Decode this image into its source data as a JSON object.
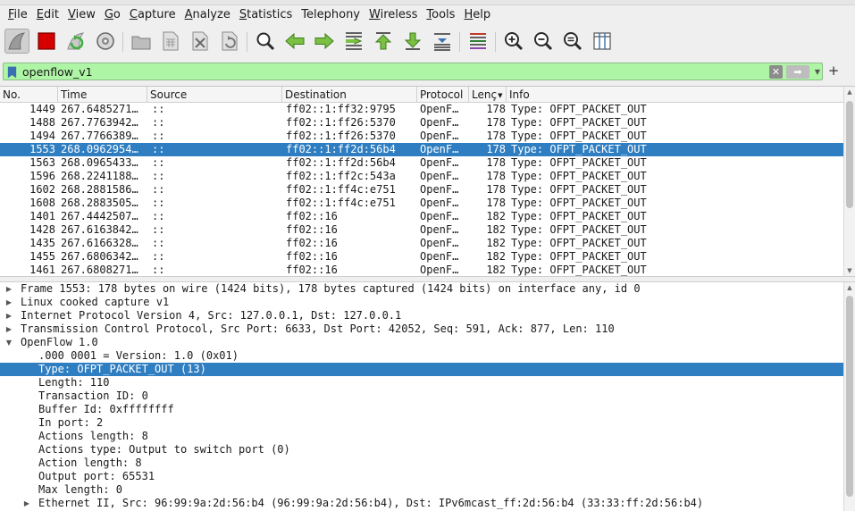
{
  "menu": [
    {
      "label": "File",
      "accel": "F",
      "rest": "ile"
    },
    {
      "label": "Edit",
      "accel": "E",
      "rest": "dit"
    },
    {
      "label": "View",
      "accel": "V",
      "rest": "iew"
    },
    {
      "label": "Go",
      "accel": "G",
      "rest": "o"
    },
    {
      "label": "Capture",
      "accel": "C",
      "rest": "apture"
    },
    {
      "label": "Analyze",
      "accel": "A",
      "rest": "nalyze"
    },
    {
      "label": "Statistics",
      "accel": "S",
      "rest": "tatistics"
    },
    {
      "label": "Telephony",
      "accel": "",
      "rest": "Telephony"
    },
    {
      "label": "Wireless",
      "accel": "W",
      "rest": "ireless"
    },
    {
      "label": "Tools",
      "accel": "T",
      "rest": "ools"
    },
    {
      "label": "Help",
      "accel": "H",
      "rest": "elp"
    }
  ],
  "toolbar": {
    "icons": [
      "shark-fin-start-icon",
      "stop-capture-icon",
      "restart-capture-icon",
      "capture-options-icon",
      "open-file-icon",
      "save-file-icon",
      "close-file-icon",
      "reload-file-icon",
      "find-packet-icon",
      "go-back-icon",
      "go-forward-icon",
      "go-to-packet-icon",
      "go-first-icon",
      "go-last-icon",
      "autoscroll-icon",
      "colorize-icon",
      "zoom-in-icon",
      "zoom-out-icon",
      "zoom-normal-icon",
      "resize-columns-icon"
    ],
    "accent_green": "#3fae3f",
    "accent_red": "#d60000"
  },
  "filter": {
    "value": "openflow_v1",
    "background": "#aff5a6",
    "plus": "+"
  },
  "packet_list": {
    "columns": [
      "No.",
      "Time",
      "Source",
      "Destination",
      "Protocol",
      "Lenç",
      "Info"
    ],
    "selected_color": "#2f7ec1",
    "rows": [
      {
        "no": "1449",
        "time": "267.6485271…",
        "src": "::",
        "dst": "ff02::1:ff32:9795",
        "proto": "OpenF…",
        "len": "178",
        "info": "Type: OFPT_PACKET_OUT"
      },
      {
        "no": "1488",
        "time": "267.7763942…",
        "src": "::",
        "dst": "ff02::1:ff26:5370",
        "proto": "OpenF…",
        "len": "178",
        "info": "Type: OFPT_PACKET_OUT"
      },
      {
        "no": "1494",
        "time": "267.7766389…",
        "src": "::",
        "dst": "ff02::1:ff26:5370",
        "proto": "OpenF…",
        "len": "178",
        "info": "Type: OFPT_PACKET_OUT"
      },
      {
        "no": "1553",
        "time": "268.0962954…",
        "src": "::",
        "dst": "ff02::1:ff2d:56b4",
        "proto": "OpenF…",
        "len": "178",
        "info": "Type: OFPT_PACKET_OUT"
      },
      {
        "no": "1563",
        "time": "268.0965433…",
        "src": "::",
        "dst": "ff02::1:ff2d:56b4",
        "proto": "OpenF…",
        "len": "178",
        "info": "Type: OFPT_PACKET_OUT"
      },
      {
        "no": "1596",
        "time": "268.2241188…",
        "src": "::",
        "dst": "ff02::1:ff2c:543a",
        "proto": "OpenF…",
        "len": "178",
        "info": "Type: OFPT_PACKET_OUT"
      },
      {
        "no": "1602",
        "time": "268.2881586…",
        "src": "::",
        "dst": "ff02::1:ff4c:e751",
        "proto": "OpenF…",
        "len": "178",
        "info": "Type: OFPT_PACKET_OUT"
      },
      {
        "no": "1608",
        "time": "268.2883505…",
        "src": "::",
        "dst": "ff02::1:ff4c:e751",
        "proto": "OpenF…",
        "len": "178",
        "info": "Type: OFPT_PACKET_OUT"
      },
      {
        "no": "1401",
        "time": "267.4442507…",
        "src": "::",
        "dst": "ff02::16",
        "proto": "OpenF…",
        "len": "182",
        "info": "Type: OFPT_PACKET_OUT"
      },
      {
        "no": "1428",
        "time": "267.6163842…",
        "src": "::",
        "dst": "ff02::16",
        "proto": "OpenF…",
        "len": "182",
        "info": "Type: OFPT_PACKET_OUT"
      },
      {
        "no": "1435",
        "time": "267.6166328…",
        "src": "::",
        "dst": "ff02::16",
        "proto": "OpenF…",
        "len": "182",
        "info": "Type: OFPT_PACKET_OUT"
      },
      {
        "no": "1455",
        "time": "267.6806342…",
        "src": "::",
        "dst": "ff02::16",
        "proto": "OpenF…",
        "len": "182",
        "info": "Type: OFPT_PACKET_OUT"
      },
      {
        "no": "1461",
        "time": "267.6808271…",
        "src": "::",
        "dst": "ff02::16",
        "proto": "OpenF…",
        "len": "182",
        "info": "Type: OFPT_PACKET_OUT"
      }
    ],
    "selected_index": 3
  },
  "details": {
    "rows": [
      {
        "level": 0,
        "expander": "collapsed",
        "text": "Frame 1553: 178 bytes on wire (1424 bits), 178 bytes captured (1424 bits) on interface any, id 0"
      },
      {
        "level": 0,
        "expander": "collapsed",
        "text": "Linux cooked capture v1"
      },
      {
        "level": 0,
        "expander": "collapsed",
        "text": "Internet Protocol Version 4, Src: 127.0.0.1, Dst: 127.0.0.1"
      },
      {
        "level": 0,
        "expander": "collapsed",
        "text": "Transmission Control Protocol, Src Port: 6633, Dst Port: 42052, Seq: 591, Ack: 877, Len: 110"
      },
      {
        "level": 0,
        "expander": "expanded",
        "text": "OpenFlow 1.0"
      },
      {
        "level": 1,
        "expander": "none",
        "text": ".000 0001 = Version: 1.0 (0x01)"
      },
      {
        "level": 1,
        "expander": "none",
        "text": "Type: OFPT_PACKET_OUT (13)"
      },
      {
        "level": 1,
        "expander": "none",
        "text": "Length: 110"
      },
      {
        "level": 1,
        "expander": "none",
        "text": "Transaction ID: 0"
      },
      {
        "level": 1,
        "expander": "none",
        "text": "Buffer Id: 0xffffffff"
      },
      {
        "level": 1,
        "expander": "none",
        "text": "In port: 2"
      },
      {
        "level": 1,
        "expander": "none",
        "text": "Actions length: 8"
      },
      {
        "level": 1,
        "expander": "none",
        "text": "Actions type: Output to switch port (0)"
      },
      {
        "level": 1,
        "expander": "none",
        "text": "Action length: 8"
      },
      {
        "level": 1,
        "expander": "none",
        "text": "Output port: 65531"
      },
      {
        "level": 1,
        "expander": "none",
        "text": "Max length: 0"
      },
      {
        "level": 1,
        "expander": "collapsed",
        "text": "Ethernet II, Src: 96:99:9a:2d:56:b4 (96:99:9a:2d:56:b4), Dst: IPv6mcast_ff:2d:56:b4 (33:33:ff:2d:56:b4)"
      }
    ],
    "selected_index": 6
  }
}
